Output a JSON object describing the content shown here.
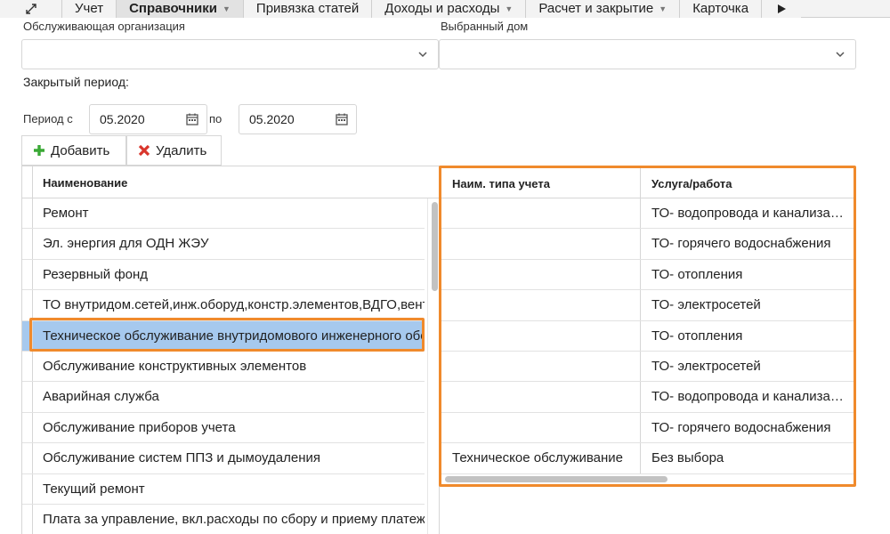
{
  "menu": {
    "items": [
      {
        "label": "Учет",
        "chevron": false,
        "active": false
      },
      {
        "label": "Справочники",
        "chevron": true,
        "active": true
      },
      {
        "label": "Привязка статей",
        "chevron": false,
        "active": false
      },
      {
        "label": "Доходы и расходы",
        "chevron": true,
        "active": false
      },
      {
        "label": "Расчет и закрытие",
        "chevron": true,
        "active": false
      },
      {
        "label": "Карточка",
        "chevron": false,
        "active": false
      }
    ],
    "first_icon": "expand-icon",
    "last_icon": "play-icon"
  },
  "filters": {
    "org_label": "Обслуживающая организация",
    "org_value": "",
    "house_label": "Выбранный дом",
    "house_value": ""
  },
  "period": {
    "closed_label": "Закрытый период:",
    "from_label": "Период с",
    "from_value": "05.2020",
    "to_label": "по",
    "to_value": "05.2020"
  },
  "toolbar": {
    "add_label": "Добавить",
    "delete_label": "Удалить"
  },
  "left_grid": {
    "header": "Наименование",
    "rows": [
      "Ремонт",
      "Эл. энергия для ОДН ЖЭУ",
      "Резервный фонд",
      "ТО внутридом.сетей,инж.оборуд,констр.элементов,ВДГО,вент",
      "Техническое обслуживание внутридомового инженерного оборудования",
      "Обслуживание конструктивных элементов",
      "Аварийная служба",
      "Обслуживание приборов учета",
      "Обслуживание систем ППЗ и дымоудаления",
      "Текущий ремонт",
      "Плата за управление, вкл.расходы по сбору и приему платежей"
    ],
    "selected_index": 4
  },
  "right_grid": {
    "headers": [
      "Наим. типа учета",
      "Услуга/работа"
    ],
    "rows": [
      [
        "",
        "ТО- водопровода и канализации"
      ],
      [
        "",
        "ТО- горячего водоснабжения"
      ],
      [
        "",
        "ТО- отопления"
      ],
      [
        "",
        "ТО- электросетей"
      ],
      [
        "",
        "ТО- отопления"
      ],
      [
        "",
        "ТО- электросетей"
      ],
      [
        "",
        "ТО- водопровода и канализации"
      ],
      [
        "",
        "ТО- горячего водоснабжения"
      ],
      [
        "Техническое обслуживание",
        "Без выбора"
      ]
    ]
  },
  "colors": {
    "highlight": "#f08a2c",
    "selected_row": "#a6c9ee",
    "add_icon": "#3aa935",
    "delete_icon": "#d9352b"
  }
}
